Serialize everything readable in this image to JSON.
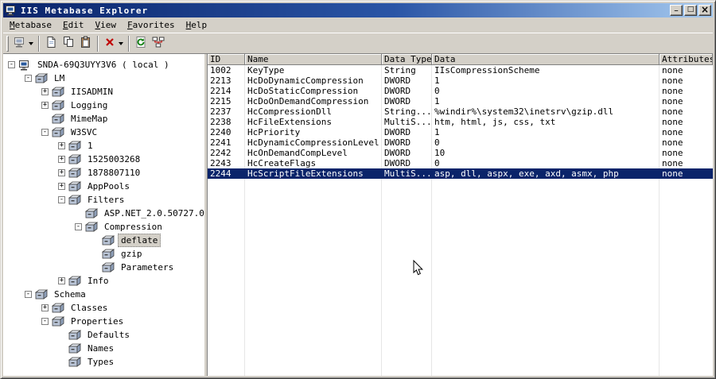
{
  "window": {
    "title": "IIS Metabase Explorer",
    "controls": [
      "minimize",
      "maximize",
      "close"
    ]
  },
  "menu": {
    "items": [
      "Metabase",
      "Edit",
      "View",
      "Favorites",
      "Help"
    ]
  },
  "toolbar": {
    "buttons": [
      {
        "name": "connect",
        "has_dropdown": true
      },
      {
        "name": "new-key",
        "has_dropdown": false
      },
      {
        "name": "copy",
        "has_dropdown": false
      },
      {
        "name": "paste",
        "has_dropdown": false
      },
      {
        "name": "delete",
        "has_dropdown": true
      },
      {
        "name": "refresh",
        "has_dropdown": false
      },
      {
        "name": "network",
        "has_dropdown": false
      }
    ]
  },
  "tree": {
    "items": [
      {
        "label": "SNDA-69Q3UYY3V6 ( local )",
        "depth": 0,
        "icon": "computer",
        "expander": "-",
        "selected": false
      },
      {
        "label": "LM",
        "depth": 1,
        "icon": "drawer",
        "expander": "-",
        "selected": false
      },
      {
        "label": "IISADMIN",
        "depth": 2,
        "icon": "drawer",
        "expander": "+",
        "selected": false
      },
      {
        "label": "Logging",
        "depth": 2,
        "icon": "drawer",
        "expander": "+",
        "selected": false
      },
      {
        "label": "MimeMap",
        "depth": 2,
        "icon": "drawer",
        "expander": "",
        "selected": false
      },
      {
        "label": "W3SVC",
        "depth": 2,
        "icon": "drawer",
        "expander": "-",
        "selected": false
      },
      {
        "label": "1",
        "depth": 3,
        "icon": "drawer",
        "expander": "+",
        "selected": false
      },
      {
        "label": "1525003268",
        "depth": 3,
        "icon": "drawer",
        "expander": "+",
        "selected": false
      },
      {
        "label": "1878807110",
        "depth": 3,
        "icon": "drawer",
        "expander": "+",
        "selected": false
      },
      {
        "label": "AppPools",
        "depth": 3,
        "icon": "drawer",
        "expander": "+",
        "selected": false
      },
      {
        "label": "Filters",
        "depth": 3,
        "icon": "drawer",
        "expander": "-",
        "selected": false
      },
      {
        "label": "ASP.NET_2.0.50727.0",
        "depth": 4,
        "icon": "drawer",
        "expander": "",
        "selected": false
      },
      {
        "label": "Compression",
        "depth": 4,
        "icon": "drawer",
        "expander": "-",
        "selected": false
      },
      {
        "label": "deflate",
        "depth": 5,
        "icon": "drawer",
        "expander": "",
        "selected": true
      },
      {
        "label": "gzip",
        "depth": 5,
        "icon": "drawer",
        "expander": "",
        "selected": false
      },
      {
        "label": "Parameters",
        "depth": 5,
        "icon": "drawer",
        "expander": "",
        "selected": false
      },
      {
        "label": "Info",
        "depth": 3,
        "icon": "drawer",
        "expander": "+",
        "selected": false
      },
      {
        "label": "Schema",
        "depth": 1,
        "icon": "drawer",
        "expander": "-",
        "selected": false
      },
      {
        "label": "Classes",
        "depth": 2,
        "icon": "drawer",
        "expander": "+",
        "selected": false
      },
      {
        "label": "Properties",
        "depth": 2,
        "icon": "drawer",
        "expander": "-",
        "selected": false
      },
      {
        "label": "Defaults",
        "depth": 3,
        "icon": "drawer",
        "expander": "",
        "selected": false
      },
      {
        "label": "Names",
        "depth": 3,
        "icon": "drawer",
        "expander": "",
        "selected": false
      },
      {
        "label": "Types",
        "depth": 3,
        "icon": "drawer",
        "expander": "",
        "selected": false
      }
    ]
  },
  "list": {
    "columns": [
      "ID",
      "Name",
      "Data Type",
      "Data",
      "Attributes"
    ],
    "rows": [
      {
        "id": "1002",
        "name": "KeyType",
        "type": "String",
        "data": "IIsCompressionScheme",
        "attributes": "none",
        "selected": false
      },
      {
        "id": "2213",
        "name": "HcDoDynamicCompression",
        "type": "DWORD",
        "data": "1",
        "attributes": "none",
        "selected": false
      },
      {
        "id": "2214",
        "name": "HcDoStaticCompression",
        "type": "DWORD",
        "data": "0",
        "attributes": "none",
        "selected": false
      },
      {
        "id": "2215",
        "name": "HcDoOnDemandCompression",
        "type": "DWORD",
        "data": "1",
        "attributes": "none",
        "selected": false
      },
      {
        "id": "2237",
        "name": "HcCompressionDll",
        "type": "String...",
        "data": "%windir%\\system32\\inetsrv\\gzip.dll",
        "attributes": "none",
        "selected": false
      },
      {
        "id": "2238",
        "name": "HcFileExtensions",
        "type": "MultiS...",
        "data": "htm, html, js, css, txt",
        "attributes": "none",
        "selected": false
      },
      {
        "id": "2240",
        "name": "HcPriority",
        "type": "DWORD",
        "data": "1",
        "attributes": "none",
        "selected": false
      },
      {
        "id": "2241",
        "name": "HcDynamicCompressionLevel",
        "type": "DWORD",
        "data": "0",
        "attributes": "none",
        "selected": false
      },
      {
        "id": "2242",
        "name": "HcOnDemandCompLevel",
        "type": "DWORD",
        "data": "10",
        "attributes": "none",
        "selected": false
      },
      {
        "id": "2243",
        "name": "HcCreateFlags",
        "type": "DWORD",
        "data": "0",
        "attributes": "none",
        "selected": false
      },
      {
        "id": "2244",
        "name": "HcScriptFileExtensions",
        "type": "MultiS...",
        "data": "asp, dll, aspx, exe, axd, asmx, php",
        "attributes": "none",
        "selected": true
      }
    ]
  },
  "colors": {
    "titlebar_start": "#0a246a",
    "titlebar_end": "#a6caf0",
    "selection": "#0a246a",
    "chrome": "#d4d0c8",
    "tree_inactive_selection": "#d4d0c8"
  }
}
